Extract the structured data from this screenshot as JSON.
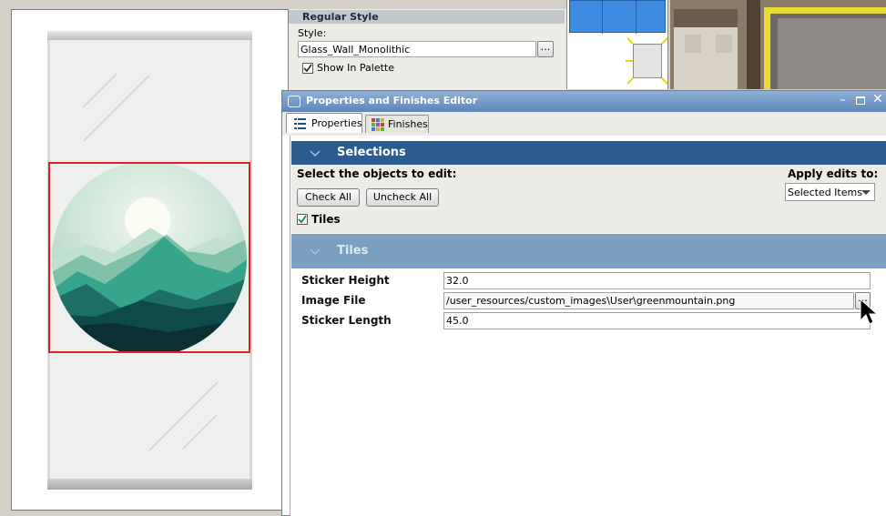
{
  "style_panel": {
    "header": "Regular Style",
    "style_label": "Style:",
    "style_value": "Glass_Wall_Monolithic",
    "browse_label": "...",
    "show_in_palette_label": "Show In Palette",
    "show_in_palette_checked": true
  },
  "editor": {
    "title": "Properties and Finishes Editor",
    "tabs": [
      {
        "label": "Properties",
        "icon": "list-icon",
        "active": true
      },
      {
        "label": "Finishes",
        "icon": "grid-icon",
        "active": false
      }
    ],
    "selections": {
      "header": "Selections",
      "prompt": "Select the objects to edit:",
      "apply_label": "Apply edits to:",
      "apply_value": "Selected Items",
      "check_all": "Check All",
      "uncheck_all": "Uncheck All",
      "tiles_checkbox_label": "Tiles",
      "tiles_checked": true
    },
    "tiles_section": {
      "header": "Tiles",
      "properties": [
        {
          "label": "Sticker Height",
          "value": "32.0"
        },
        {
          "label": "Image File",
          "value": "/user_resources/custom_images\\User\\greenmountain.png"
        },
        {
          "label": "Sticker Length",
          "value": "45.0"
        }
      ],
      "browse_label": "..."
    }
  },
  "colors": {
    "selection_header_bg": "#2c5b8e",
    "tiles_header_bg": "#7b9fbe",
    "sticker_outline": "#e02020"
  }
}
